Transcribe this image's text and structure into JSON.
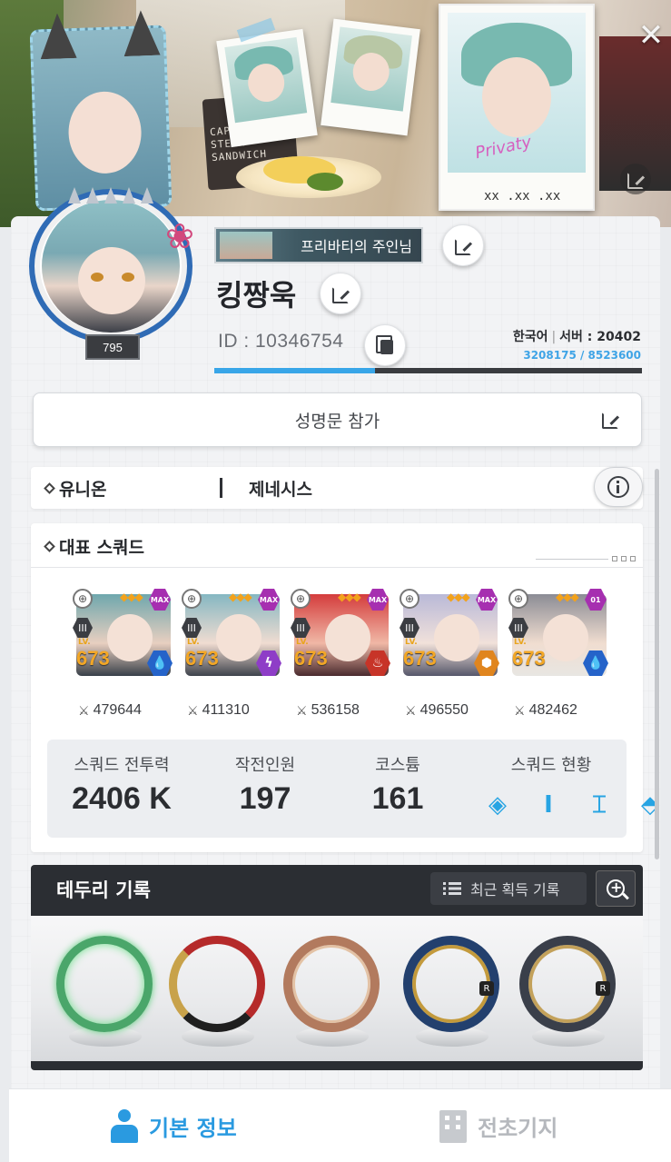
{
  "profile": {
    "title_badge": "프리바티의 주인님",
    "nickname": "킹짱욱",
    "id_label": "ID : 10346754",
    "level": "795",
    "language": "한국어",
    "server": "서버 : 20402",
    "exp": "3208175 / 8523600",
    "exp_progress": 0.376
  },
  "pledge": {
    "label": "성명문 참가"
  },
  "union": {
    "label": "유니온",
    "guild": "제네시스"
  },
  "squad": {
    "title": "대표 스쿼드",
    "units": [
      {
        "level": "673",
        "burst": "III",
        "lv_label": "LV.",
        "badge": "MAX",
        "power": "479644",
        "elem": "water"
      },
      {
        "level": "673",
        "burst": "III",
        "lv_label": "LV.",
        "badge": "MAX",
        "power": "411310",
        "elem": "electric"
      },
      {
        "level": "673",
        "burst": "III",
        "lv_label": "LV.",
        "badge": "MAX",
        "power": "536158",
        "elem": "fire"
      },
      {
        "level": "673",
        "burst": "III",
        "lv_label": "LV.",
        "badge": "MAX",
        "power": "496550",
        "elem": "iron"
      },
      {
        "level": "673",
        "burst": "III",
        "lv_label": "LV.",
        "badge": "01",
        "power": "482462",
        "elem": "water"
      }
    ],
    "stats": {
      "power_label": "스쿼드 전투력",
      "power_value": "2406 K",
      "members_label": "작전인원",
      "members_value": "197",
      "costume_label": "코스튬",
      "costume_value": "161",
      "status_label": "스쿼드 현황"
    }
  },
  "frames": {
    "title": "테두리 기록",
    "recent_label": "최근 획득 기록",
    "items": [
      {
        "icon": "green-ring-frame-icon",
        "rarity": ""
      },
      {
        "icon": "red-fan-frame-icon",
        "rarity": ""
      },
      {
        "icon": "bronze-winged-frame-icon",
        "rarity": ""
      },
      {
        "icon": "blue-gold-frame-icon",
        "rarity": "R"
      },
      {
        "icon": "mech-frame-icon",
        "rarity": "R"
      }
    ]
  },
  "tabs": {
    "basic": "기본 정보",
    "base": "전초기지"
  },
  "colors": {
    "accent": "#2a9ae0",
    "exp_fill": "#39a6e8",
    "level_orange": "#f3a726",
    "max_badge": "#a62fb0"
  }
}
